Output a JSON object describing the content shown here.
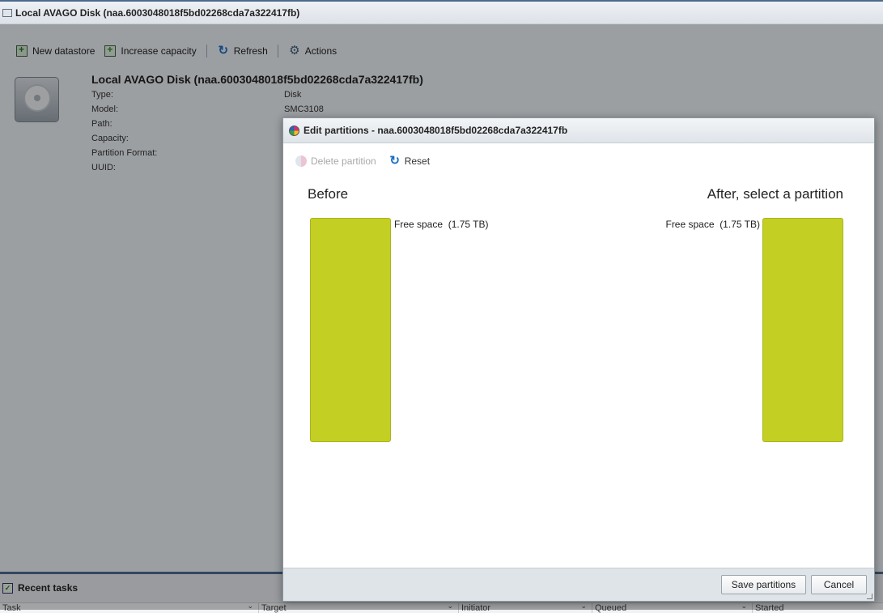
{
  "window": {
    "title": "Local AVAGO Disk (naa.6003048018f5bd02268cda7a322417fb)"
  },
  "toolbar": {
    "new_datastore": "New datastore",
    "increase_capacity": "Increase capacity",
    "refresh": "Refresh",
    "actions": "Actions"
  },
  "disk": {
    "title": "Local AVAGO Disk (naa.6003048018f5bd02268cda7a322417fb)",
    "properties": [
      {
        "label": "Type:",
        "value": "Disk"
      },
      {
        "label": "Model:",
        "value": "SMC3108"
      },
      {
        "label": "Path:",
        "value": ""
      },
      {
        "label": "Capacity:",
        "value": ""
      },
      {
        "label": "Partition Format:",
        "value": ""
      },
      {
        "label": "UUID:",
        "value": ""
      }
    ]
  },
  "recent_tasks": {
    "title": "Recent tasks",
    "columns": [
      "Task",
      "Target",
      "Initiator",
      "Queued",
      "Started"
    ]
  },
  "dialog": {
    "title": "Edit partitions - naa.6003048018f5bd02268cda7a322417fb",
    "delete_partition": "Delete partition",
    "reset": "Reset",
    "before_heading": "Before",
    "after_heading": "After, select a partition",
    "before_partition": {
      "name": "Free space",
      "size": "(1.75 TB)",
      "color": "#c3cf23"
    },
    "after_partition": {
      "name": "Free space",
      "size": "(1.75 TB)",
      "color": "#c3cf23"
    },
    "save_button": "Save partitions",
    "cancel_button": "Cancel"
  }
}
